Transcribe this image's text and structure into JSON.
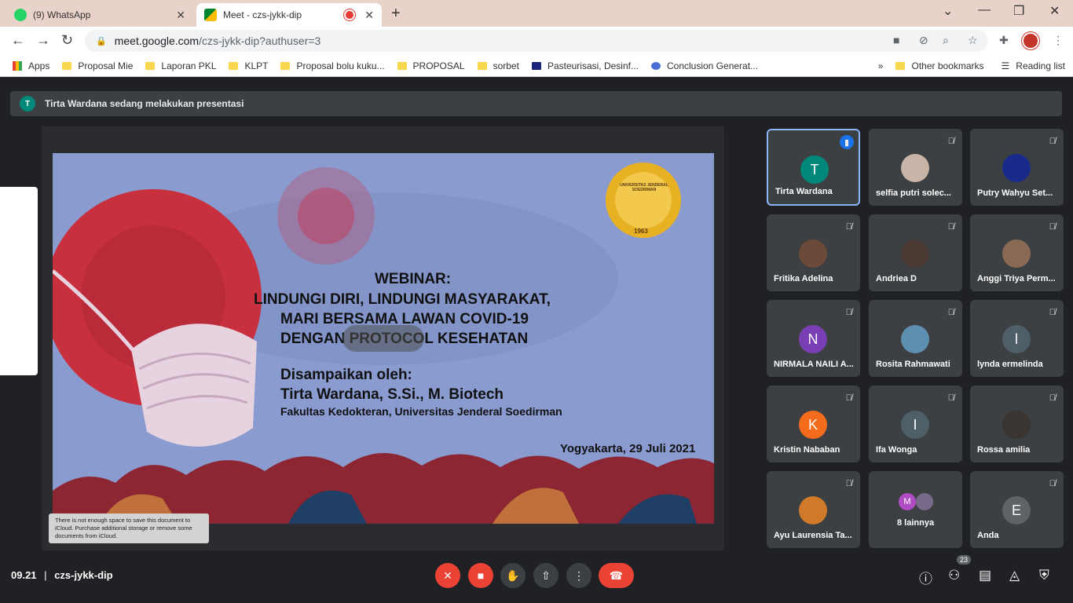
{
  "browser": {
    "tabs": [
      {
        "title": "(9) WhatsApp",
        "active": false
      },
      {
        "title": "Meet - czs-jykk-dip",
        "active": true
      }
    ],
    "url_host": "meet.google.com",
    "url_path": "/czs-jykk-dip?authuser=3",
    "bookmarks": [
      "Apps",
      "Proposal Mie",
      "Laporan PKL",
      "KLPT",
      "Proposal bolu kuku...",
      "PROPOSAL",
      "sorbet",
      "Pasteurisasi, Desinf...",
      "Conclusion Generat..."
    ],
    "other_bookmarks": "Other bookmarks",
    "reading_list": "Reading list",
    "more_bookmarks": "»"
  },
  "meet": {
    "presenting": "Tirta Wardana sedang melakukan presentasi",
    "presenter_initial": "T",
    "slide": {
      "line1": "WEBINAR:",
      "line2": "LINDUNGI DIRI, LINDUNGI MASYARAKAT,",
      "line3": "MARI BERSAMA LAWAN COVID-19",
      "line4": "DENGAN PROTOCOL KESEHATAN",
      "by_label": "Disampaikan oleh:",
      "speaker": "Tirta Wardana, S.Si., M. Biotech",
      "affiliation": "Fakultas Kedokteran, Universitas Jenderal Soedirman",
      "place_date": "Yogyakarta, 29 Juli 2021",
      "logo_top": "UNIVERSITAS JENDERAL SOEDIRMAN",
      "logo_year": "1963"
    },
    "icloud_note": "There is not enough space to save this document to iCloud. Purchase additional storage or remove some documents from iCloud.",
    "participants": [
      {
        "name": "Tirta Wardana",
        "initial": "T",
        "color": "#00897b",
        "speaking": true
      },
      {
        "name": "selfia putri solec...",
        "initial": "",
        "color": "#c9b5a8"
      },
      {
        "name": "Putry Wahyu Set...",
        "initial": "",
        "color": "#1a2a8a"
      },
      {
        "name": "Fritika Adelina",
        "initial": "",
        "color": "#6b4a3a"
      },
      {
        "name": "Andriea D",
        "initial": "",
        "color": "#4a3a33"
      },
      {
        "name": "Anggi Triya Perm...",
        "initial": "",
        "color": "#8a6a55"
      },
      {
        "name": "NIRMALA NAILI A...",
        "initial": "N",
        "color": "#7b3fb5"
      },
      {
        "name": "Rosita Rahmawati",
        "initial": "",
        "color": "#5f8fb0"
      },
      {
        "name": "lynda ermelinda",
        "initial": "l",
        "color": "#4e5f68"
      },
      {
        "name": "Kristin Nababan",
        "initial": "K",
        "color": "#f46c1b"
      },
      {
        "name": "Ifa Wonga",
        "initial": "I",
        "color": "#4e5f68"
      },
      {
        "name": "Rossa amilia",
        "initial": "",
        "color": "#3a3530"
      },
      {
        "name": "Ayu Laurensia Ta...",
        "initial": "",
        "color": "#d07a2a"
      },
      {
        "name": "8 lainnya",
        "initial": "M",
        "color": "#b04cc4"
      },
      {
        "name": "Anda",
        "initial": "E",
        "color": "#5f6368"
      }
    ],
    "time": "09.21",
    "meeting_code": "czs-jykk-dip",
    "participant_count": "23"
  }
}
